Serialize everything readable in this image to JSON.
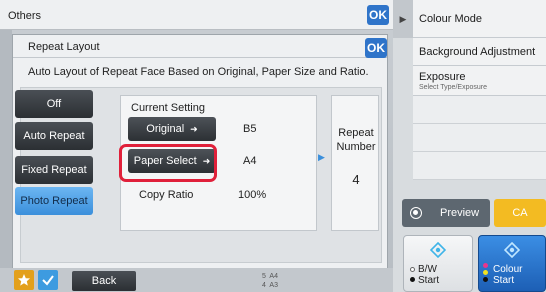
{
  "header": {
    "title": "Others",
    "ok_label": "OK"
  },
  "side_menu": {
    "items": [
      {
        "title": "Colour Mode"
      },
      {
        "title": "Background Adjustment"
      },
      {
        "title": "Exposure",
        "subtitle": "Select Type/Exposure"
      }
    ]
  },
  "dialog": {
    "title": "Repeat Layout",
    "ok_label": "OK",
    "description": "Auto Layout of Repeat Face Based on Original, Paper Size and Ratio.",
    "modes": [
      {
        "label": "Off"
      },
      {
        "label": "Auto Repeat"
      },
      {
        "label": "Fixed Repeat"
      },
      {
        "label": "Photo Repeat",
        "selected": true
      }
    ],
    "current_setting": {
      "label": "Current Setting",
      "original_label": "Original",
      "original_value": "B5",
      "paper_label": "Paper Select",
      "paper_value": "A4",
      "ratio_label": "Copy Ratio",
      "ratio_value": "100%"
    },
    "repeat": {
      "label": "Repeat Number",
      "value": "4"
    }
  },
  "actions": {
    "preview_label": "Preview",
    "ca_label": "CA",
    "bw_start_label": "B/W\nStart",
    "colour_start_label": "Colour\nStart"
  },
  "bottom": {
    "back_label": "Back",
    "status_top": "5  A4",
    "status_bottom": "4  A3"
  },
  "colors": {
    "accent_blue": "#2f74c9",
    "highlight_red": "#e0203a",
    "ca_yellow": "#f3bb22",
    "colour_start_blue": "#1d5fb5"
  }
}
